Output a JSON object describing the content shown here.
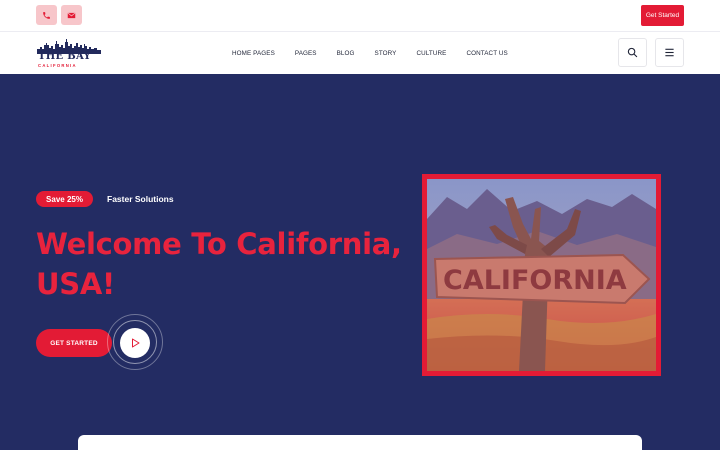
{
  "topbar": {
    "phone_icon": "phone-icon",
    "email_icon": "envelope-icon",
    "cta_label": "Get Started"
  },
  "brand": {
    "name": "THE BAY",
    "tagline": "CALIFORNIA"
  },
  "nav": {
    "items": [
      {
        "label": "HOME PAGES"
      },
      {
        "label": "PAGES"
      },
      {
        "label": "BLOG"
      },
      {
        "label": "STORY"
      },
      {
        "label": "CULTURE"
      },
      {
        "label": "CONTACT US"
      }
    ],
    "search_icon": "search-icon",
    "menu_icon": "hamburger-menu-icon"
  },
  "hero": {
    "badge": "Save 25%",
    "badge_caption": "Faster Solutions",
    "title_line1": "Welcome To California,",
    "title_line2": "USA!",
    "cta_label": "GET STARTED",
    "play_icon": "play-icon",
    "image_sign_text": "CALIFORNIA"
  },
  "colors": {
    "accent": "#e31b35",
    "hero_bg": "#232c63",
    "badge_bg_light": "#f7c6ca"
  }
}
